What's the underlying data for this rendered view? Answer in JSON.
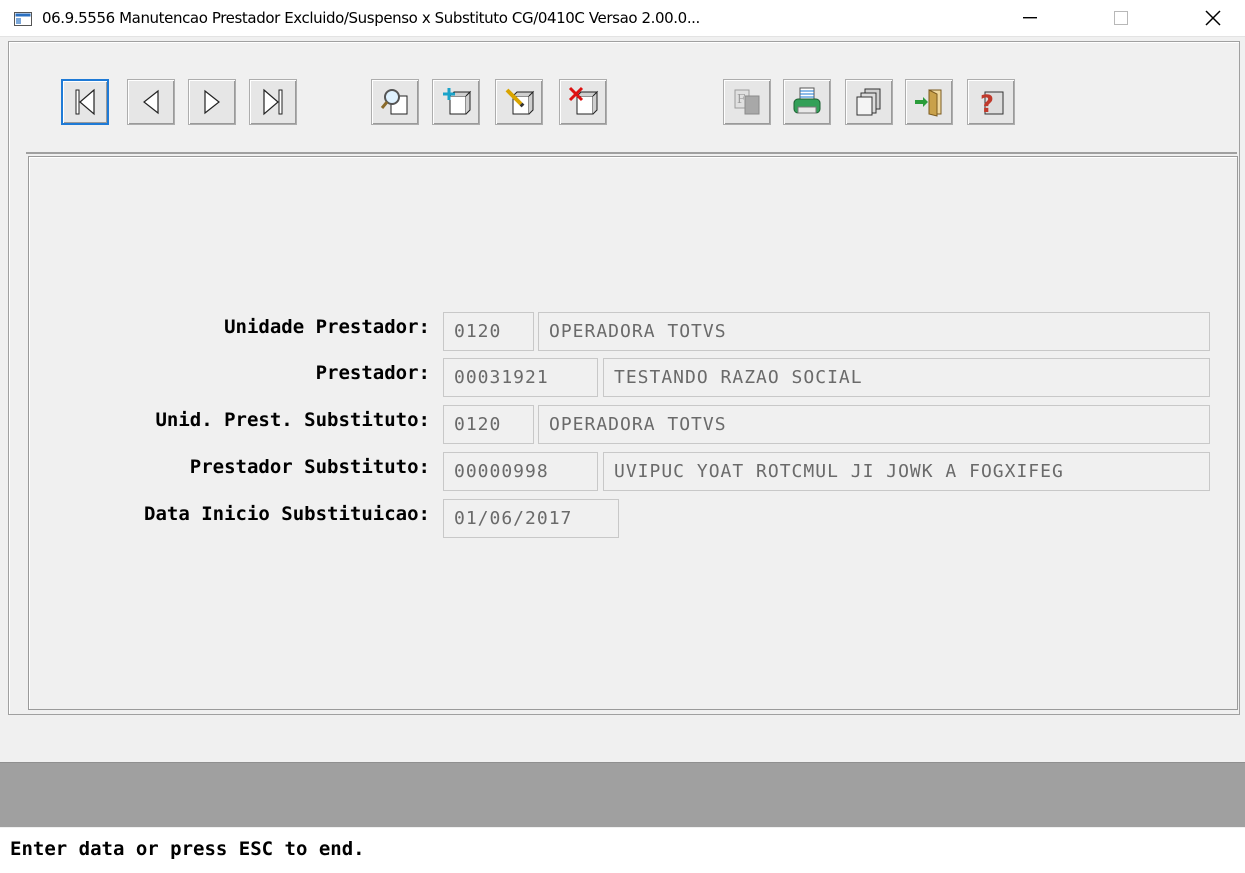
{
  "window": {
    "title": "06.9.5556 Manutencao Prestador Excluido/Suspenso x Substituto CG/0410C Versao 2.00.0...",
    "controls": [
      "minimize",
      "maximize",
      "close"
    ]
  },
  "toolbar": {
    "buttons": [
      {
        "name": "first-record",
        "icon": "first-icon"
      },
      {
        "name": "previous-record",
        "icon": "previous-icon"
      },
      {
        "name": "next-record",
        "icon": "next-icon"
      },
      {
        "name": "last-record",
        "icon": "last-icon"
      },
      {
        "name": "search",
        "icon": "magnifier-icon"
      },
      {
        "name": "add",
        "icon": "add-icon"
      },
      {
        "name": "edit",
        "icon": "edit-icon"
      },
      {
        "name": "delete",
        "icon": "delete-icon"
      },
      {
        "name": "filter",
        "icon": "filter-icon"
      },
      {
        "name": "print",
        "icon": "printer-icon"
      },
      {
        "name": "copy",
        "icon": "copy-icon"
      },
      {
        "name": "exit",
        "icon": "exit-door-icon"
      },
      {
        "name": "help",
        "icon": "help-icon"
      }
    ],
    "active_button": "first-record"
  },
  "form": {
    "unidade_prestador": {
      "label": "Unidade Prestador:",
      "code": "0120",
      "desc": "OPERADORA TOTVS"
    },
    "prestador": {
      "label": "Prestador:",
      "code": "00031921",
      "desc": "TESTANDO RAZAO SOCIAL"
    },
    "unid_prest_substituto": {
      "label": "Unid. Prest. Substituto:",
      "code": "0120",
      "desc": "OPERADORA TOTVS"
    },
    "prestador_substituto": {
      "label": "Prestador Substituto:",
      "code": "00000998",
      "desc": "UVIPUC YOAT ROTCMUL JI JOWK A FOGXIFEG"
    },
    "data_inicio": {
      "label": "Data Inicio Substituicao:",
      "value": "01/06/2017"
    }
  },
  "status": {
    "message": "Enter data or press ESC to end."
  },
  "colors": {
    "focus_border": "#1e7ad6",
    "help_icon": "#c0392b",
    "add_icon": "#1aa3c9"
  }
}
